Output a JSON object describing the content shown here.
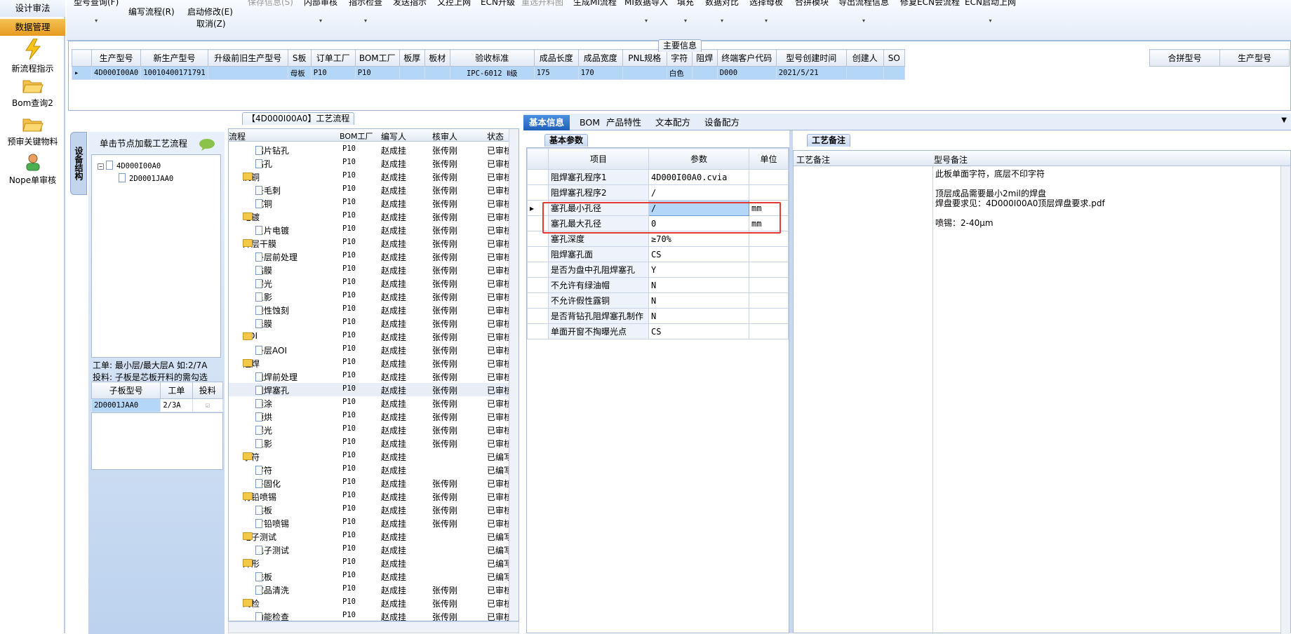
{
  "nav": {
    "tab1": "设计审法",
    "tab2": "数据管理",
    "items": [
      "新流程指示",
      "Bom查询2",
      "预审关键物料",
      "Nope单审核"
    ]
  },
  "toolbar": {
    "items": [
      "型号查询(F)",
      "编写流程(R)",
      "启动修改(E)",
      "取消(Z)",
      "保存信息(S)",
      "内部审核",
      "指示检查",
      "发送指示",
      "文控上网",
      "ECN升级",
      "重选开料图",
      "生成MI流程",
      "MI数据导入",
      "填充",
      "数据对比",
      "选择母板",
      "合拼模块",
      "导出流程信息",
      "修复ECN会流程",
      "ECN启动上网"
    ]
  },
  "main": {
    "title": "主要信息",
    "columns": [
      "生产型号",
      "新生产型号",
      "升级前旧生产型号",
      "S板",
      "订单工厂",
      "BOM工厂",
      "板厚",
      "板材",
      "验收标准",
      "成品长度",
      "成品宽度",
      "PNL规格",
      "字符",
      "阻焊",
      "终端客户代码",
      "型号创建时间",
      "创建人",
      "SO"
    ],
    "row": [
      "4D000I00A0",
      "10010400171791",
      "",
      "母板",
      "P10",
      "P10",
      "",
      "",
      "IPC-6012 Ⅱ级",
      "175",
      "170",
      "",
      "白色",
      "",
      "D000",
      "2021/5/21",
      "",
      ""
    ],
    "right_columns": [
      "合拼型号",
      "生产型号"
    ]
  },
  "tree": {
    "title": "【4D000I00A0】工艺流程",
    "vtab": "设备结构",
    "hint": "单击节点加载工艺流程",
    "nodes": [
      "4D000I00A0",
      "2D0001JAA0"
    ],
    "info1": "工单: 最小层/最大层A 如:2/7A",
    "info2": "投料: 子板是芯板开料的需勾选",
    "sub_columns": [
      "子板型号",
      "工单",
      "投料"
    ],
    "sub_row": [
      "2D0001JAA0",
      "2/3A",
      ""
    ]
  },
  "flow": {
    "columns": [
      "流程",
      "BOM工厂",
      "编写人",
      "核审人",
      "状态"
    ],
    "rows": [
      {
        "t": "d",
        "n": "铝片钻孔",
        "f": "P10",
        "w": "赵成挂",
        "r": "张传刚",
        "s": "已审核"
      },
      {
        "t": "d",
        "n": "钻孔",
        "f": "P10",
        "w": "赵成挂",
        "r": "张传刚",
        "s": "已审核"
      },
      {
        "t": "f",
        "n": "沉铜",
        "f": "P10",
        "w": "赵成挂",
        "r": "张传刚",
        "s": "已审核"
      },
      {
        "t": "d",
        "n": "去毛刺",
        "f": "P10",
        "w": "赵成挂",
        "r": "张传刚",
        "s": "已审核"
      },
      {
        "t": "d",
        "n": "沉铜",
        "f": "P10",
        "w": "赵成挂",
        "r": "张传刚",
        "s": "已审核"
      },
      {
        "t": "f",
        "n": "电镀",
        "f": "P10",
        "w": "赵成挂",
        "r": "张传刚",
        "s": "已审核"
      },
      {
        "t": "d",
        "n": "负片电镀",
        "f": "P10",
        "w": "赵成挂",
        "r": "张传刚",
        "s": "已审核"
      },
      {
        "t": "f",
        "n": "外层干膜",
        "f": "P10",
        "w": "赵成挂",
        "r": "张传刚",
        "s": "已审核"
      },
      {
        "t": "d",
        "n": "外层前处理",
        "f": "P10",
        "w": "赵成挂",
        "r": "张传刚",
        "s": "已审核"
      },
      {
        "t": "d",
        "n": "贴膜",
        "f": "P10",
        "w": "赵成挂",
        "r": "张传刚",
        "s": "已审核"
      },
      {
        "t": "d",
        "n": "曝光",
        "f": "P10",
        "w": "赵成挂",
        "r": "张传刚",
        "s": "已审核"
      },
      {
        "t": "d",
        "n": "显影",
        "f": "P10",
        "w": "赵成挂",
        "r": "张传刚",
        "s": "已审核"
      },
      {
        "t": "d",
        "n": "酸性蚀刻",
        "f": "P10",
        "w": "赵成挂",
        "r": "张传刚",
        "s": "已审核"
      },
      {
        "t": "d",
        "n": "退膜",
        "f": "P10",
        "w": "赵成挂",
        "r": "张传刚",
        "s": "已审核"
      },
      {
        "t": "f",
        "n": "AOI",
        "f": "P10",
        "w": "赵成挂",
        "r": "张传刚",
        "s": "已审核"
      },
      {
        "t": "d",
        "n": "外层AOI",
        "f": "P10",
        "w": "赵成挂",
        "r": "张传刚",
        "s": "已审核"
      },
      {
        "t": "f",
        "n": "阻焊",
        "f": "P10",
        "w": "赵成挂",
        "r": "张传刚",
        "s": "已审核"
      },
      {
        "t": "d",
        "n": "阻焊前处理",
        "f": "P10",
        "w": "赵成挂",
        "r": "张传刚",
        "s": "已审核"
      },
      {
        "t": "d",
        "n": "阻焊塞孔",
        "f": "P10",
        "w": "赵成挂",
        "r": "张传刚",
        "s": "已审核"
      },
      {
        "t": "d",
        "n": "喷涂",
        "f": "P10",
        "w": "赵成挂",
        "r": "张传刚",
        "s": "已审核"
      },
      {
        "t": "d",
        "n": "预烘",
        "f": "P10",
        "w": "赵成挂",
        "r": "张传刚",
        "s": "已审核"
      },
      {
        "t": "d",
        "n": "曝光",
        "f": "P10",
        "w": "赵成挂",
        "r": "张传刚",
        "s": "已审核"
      },
      {
        "t": "d",
        "n": "显影",
        "f": "P10",
        "w": "赵成挂",
        "r": "张传刚",
        "s": "已审核"
      },
      {
        "t": "f",
        "n": "字符",
        "f": "P10",
        "w": "赵成挂",
        "r": "",
        "s": "已编写"
      },
      {
        "t": "d",
        "n": "字符",
        "f": "P10",
        "w": "赵成挂",
        "r": "",
        "s": "已编写"
      },
      {
        "t": "d",
        "n": "终固化",
        "f": "P10",
        "w": "赵成挂",
        "r": "张传刚",
        "s": "已审核"
      },
      {
        "t": "f",
        "n": "有铅喷锡",
        "f": "P10",
        "w": "赵成挂",
        "r": "张传刚",
        "s": "已审核"
      },
      {
        "t": "d",
        "n": "烘板",
        "f": "P10",
        "w": "赵成挂",
        "r": "张传刚",
        "s": "已审核"
      },
      {
        "t": "d",
        "n": "有铅喷锡",
        "f": "P10",
        "w": "赵成挂",
        "r": "张传刚",
        "s": "已审核"
      },
      {
        "t": "f",
        "n": "电子测试",
        "f": "P10",
        "w": "赵成挂",
        "r": "",
        "s": "已编写"
      },
      {
        "t": "d",
        "n": "电子测试",
        "f": "P10",
        "w": "赵成挂",
        "r": "",
        "s": "已编写"
      },
      {
        "t": "f",
        "n": "外形",
        "f": "P10",
        "w": "赵成挂",
        "r": "",
        "s": "已编写"
      },
      {
        "t": "d",
        "n": "铣板",
        "f": "P10",
        "w": "赵成挂",
        "r": "",
        "s": "已编写"
      },
      {
        "t": "d",
        "n": "成品清洗",
        "f": "P10",
        "w": "赵成挂",
        "r": "张传刚",
        "s": "已审核"
      },
      {
        "t": "f",
        "n": "终检",
        "f": "P10",
        "w": "赵成挂",
        "r": "张传刚",
        "s": "已审核"
      },
      {
        "t": "d",
        "n": "功能检查",
        "f": "P10",
        "w": "赵成挂",
        "r": "张传刚",
        "s": "已审核"
      }
    ]
  },
  "tabs": [
    "基本信息",
    "BOM",
    "产品特性",
    "文本配方",
    "设备配方"
  ],
  "params": {
    "subtab": "基本参数",
    "columns": [
      "项目",
      "参数",
      "单位"
    ],
    "rows": [
      {
        "k": "阻焊塞孔程序1",
        "v": "4D000I00A0.cvia",
        "u": ""
      },
      {
        "k": "阻焊塞孔程序2",
        "v": "/",
        "u": ""
      },
      {
        "k": "塞孔最小孔径",
        "v": "/",
        "u": "mm"
      },
      {
        "k": "塞孔最大孔径",
        "v": "0",
        "u": "mm"
      },
      {
        "k": "塞孔深度",
        "v": "≥70%",
        "u": ""
      },
      {
        "k": "阻焊塞孔面",
        "v": "CS",
        "u": ""
      },
      {
        "k": "是否为盘中孔阻焊塞孔",
        "v": "Y",
        "u": ""
      },
      {
        "k": "不允许有绿油帽",
        "v": "N",
        "u": ""
      },
      {
        "k": "不允许假性露铜",
        "v": "N",
        "u": ""
      },
      {
        "k": "是否背钻孔阻焊塞孔制作",
        "v": "N",
        "u": ""
      },
      {
        "k": "单面开窗不掏曝光点",
        "v": "CS",
        "u": ""
      }
    ]
  },
  "notes": {
    "title": "工艺备注",
    "columns": [
      "工艺备注",
      "型号备注"
    ],
    "lines": [
      "此板单面字符，底层不印字符",
      "",
      "顶层成品需要最小2mil的焊盘",
      "焊盘要求见：4D000I00A0顶层焊盘要求.pdf",
      "",
      "喷锡：2-40μm"
    ]
  }
}
